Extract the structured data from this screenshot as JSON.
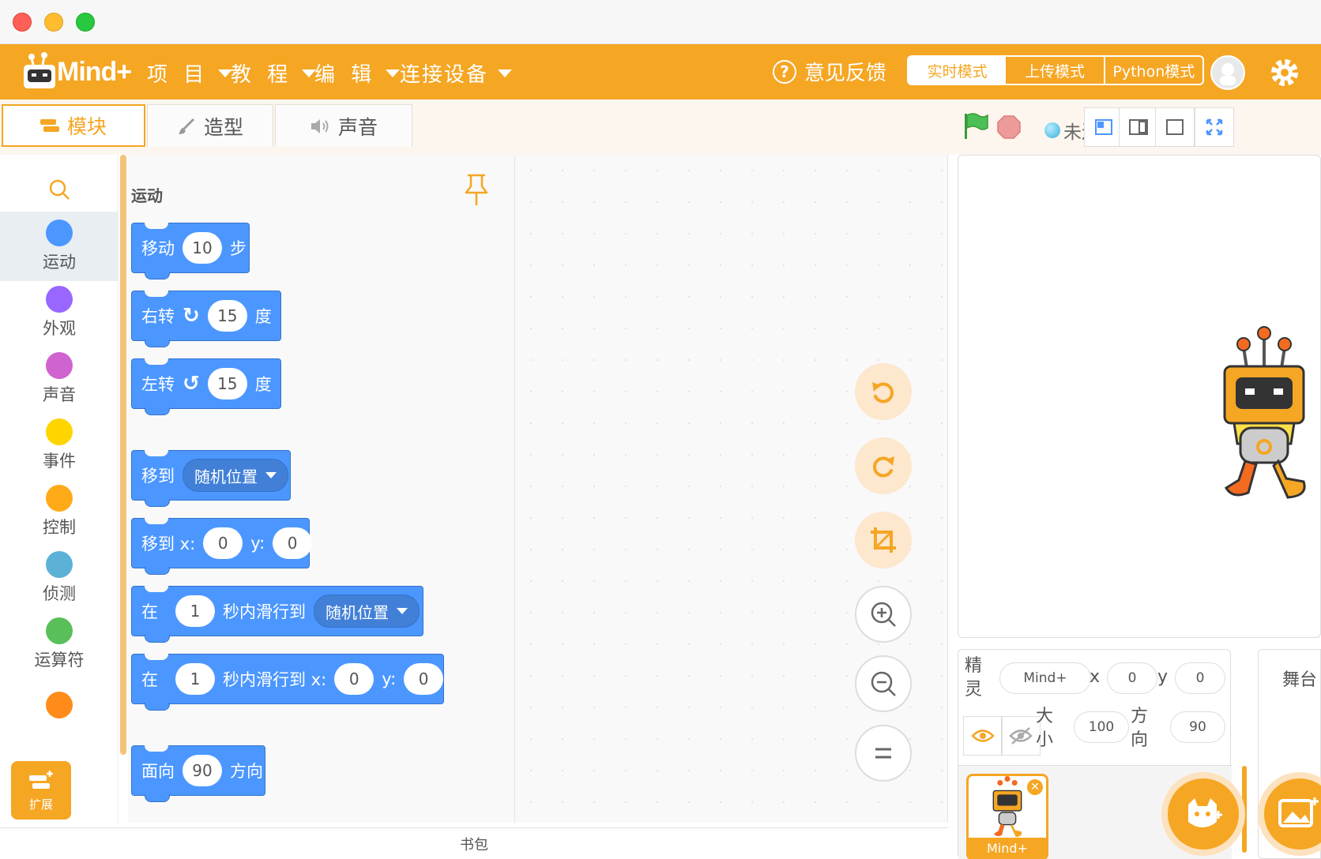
{
  "menubar": {
    "logo_text": "Mind+",
    "menus": [
      {
        "label": "项 目"
      },
      {
        "label": "教 程"
      },
      {
        "label": "编 辑"
      },
      {
        "label": "连接设备"
      }
    ],
    "feedback_label": "意见反馈",
    "modes": [
      "实时模式",
      "上传模式",
      "Python模式"
    ],
    "active_mode": "实时模式",
    "accent": "#f5a623"
  },
  "tabs": [
    {
      "label": "模块",
      "active": true
    },
    {
      "label": "造型",
      "active": false
    },
    {
      "label": "声音",
      "active": false
    }
  ],
  "toolbar": {
    "device_status": "未连接设备"
  },
  "categories": [
    {
      "label": "运动",
      "color": "#4c97ff",
      "active": true
    },
    {
      "label": "外观",
      "color": "#9966ff"
    },
    {
      "label": "声音",
      "color": "#cf63cf"
    },
    {
      "label": "事件",
      "color": "#ffd500"
    },
    {
      "label": "控制",
      "color": "#ffab19"
    },
    {
      "label": "侦测",
      "color": "#5cb1d6"
    },
    {
      "label": "运算符",
      "color": "#59c059"
    },
    {
      "label": "",
      "color": "#ff8c1a"
    }
  ],
  "extension_label": "扩展",
  "palette": {
    "title": "运动",
    "blocks": {
      "move": {
        "a": "移动",
        "val": "10",
        "b": "步"
      },
      "turn_right": {
        "a": "右转",
        "val": "15",
        "b": "度"
      },
      "turn_left": {
        "a": "左转",
        "val": "15",
        "b": "度"
      },
      "goto": {
        "a": "移到",
        "menu": "随机位置"
      },
      "goto_xy": {
        "a": "移到 x:",
        "x": "0",
        "y_label": "y:",
        "y": "0"
      },
      "glide": {
        "a": "在",
        "secs": "1",
        "b": "秒内滑行到",
        "menu": "随机位置"
      },
      "glide_xy": {
        "a": "在",
        "secs": "1",
        "b": "秒内滑行到 x:",
        "x": "0",
        "y_label": "y:",
        "y": "0"
      },
      "point": {
        "a": "面向",
        "val": "90",
        "b": "方向"
      }
    }
  },
  "backpack_label": "书包",
  "sprite_info": {
    "sprite_label_1": "精",
    "sprite_label_2": "灵",
    "name": "Mind+",
    "x_label": "x",
    "x": "0",
    "y_label": "y",
    "y": "0",
    "size_label_1": "大",
    "size_label_2": "小",
    "size": "100",
    "dir_label_1": "方",
    "dir_label_2": "向",
    "direction": "90"
  },
  "sprite_list": [
    {
      "name": "Mind+"
    }
  ],
  "stage_panel_title": "舞台"
}
